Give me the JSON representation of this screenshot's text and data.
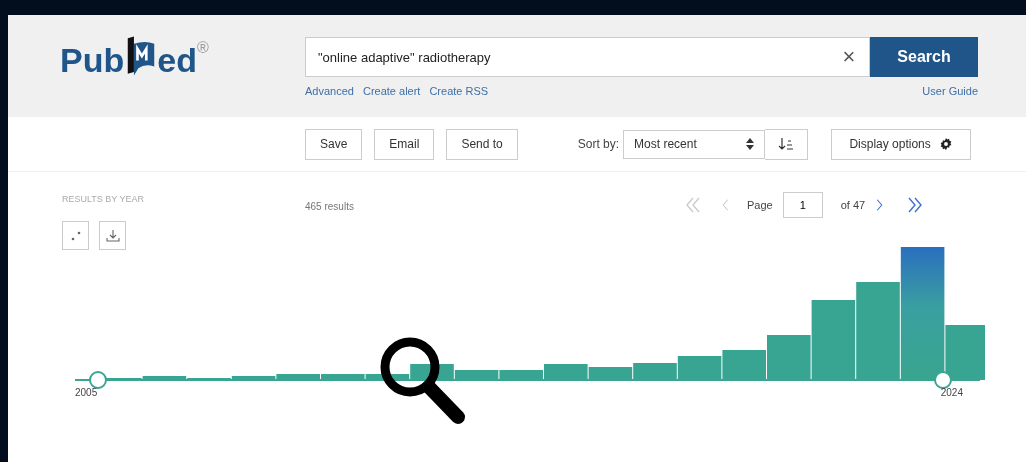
{
  "logo": {
    "text_start": "Pub",
    "text_end": "ed",
    "mark": "®"
  },
  "search": {
    "value": "\"online adaptive\" radiotherapy",
    "clear": "×",
    "button": "Search"
  },
  "search_links": [
    "Advanced",
    "Create alert",
    "Create RSS"
  ],
  "user_guide": "User Guide",
  "actions": [
    "Save",
    "Email",
    "Send to"
  ],
  "sort": {
    "label": "Sort by:",
    "value": "Most recent"
  },
  "display_options": "Display options",
  "results_by_year": {
    "title": "RESULTS BY YEAR",
    "start_year": "2005",
    "end_year": "2024"
  },
  "results_count": "465 results",
  "pagination": {
    "first_disabled": true,
    "prev_disabled": true,
    "label": "Page",
    "value": "1",
    "of": "of 47"
  }
}
